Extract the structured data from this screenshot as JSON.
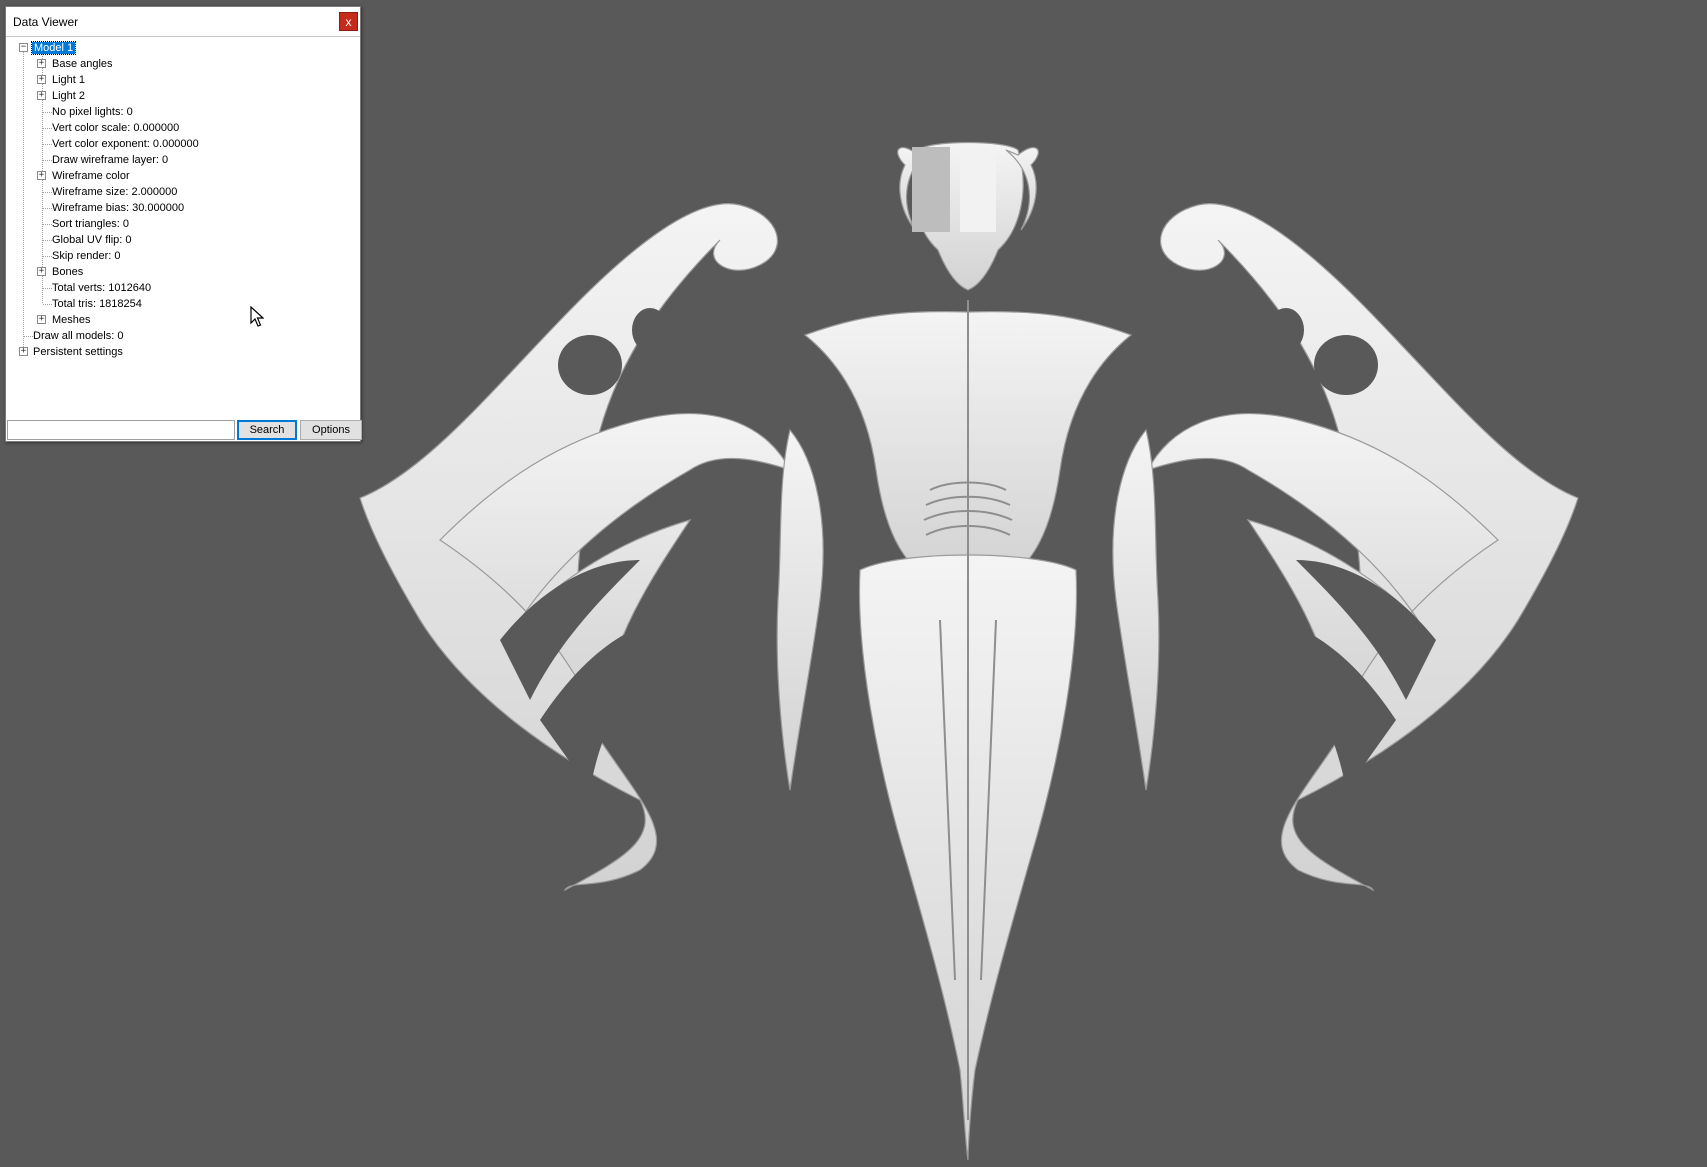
{
  "window": {
    "title": "Data Viewer",
    "close_label": "x"
  },
  "tree": {
    "root": "Model 1",
    "items": [
      "Base angles",
      "Light 1",
      "Light 2",
      "No pixel lights: 0",
      "Vert color scale: 0.000000",
      "Vert color exponent: 0.000000",
      "Draw wireframe layer: 0",
      "Wireframe color",
      "Wireframe size: 2.000000",
      "Wireframe bias: 30.000000",
      "Sort triangles: 0",
      "Global UV flip: 0",
      "Skip render: 0",
      "Bones",
      "Total verts: 1012640",
      "Total tris: 1818254",
      "Meshes"
    ],
    "bottom": [
      "Draw all models: 0",
      "Persistent settings"
    ]
  },
  "search": {
    "value": "",
    "placeholder": "",
    "search_label": "Search",
    "options_label": "Options"
  },
  "colors": {
    "viewport_background": "#595959",
    "model_fill": "#e6e6e6",
    "selection": "#0078d7",
    "close_button": "#c42b1c"
  },
  "icons": {
    "expand": "plus-box-icon",
    "collapse": "minus-box-icon",
    "cursor": "mouse-pointer-icon"
  }
}
